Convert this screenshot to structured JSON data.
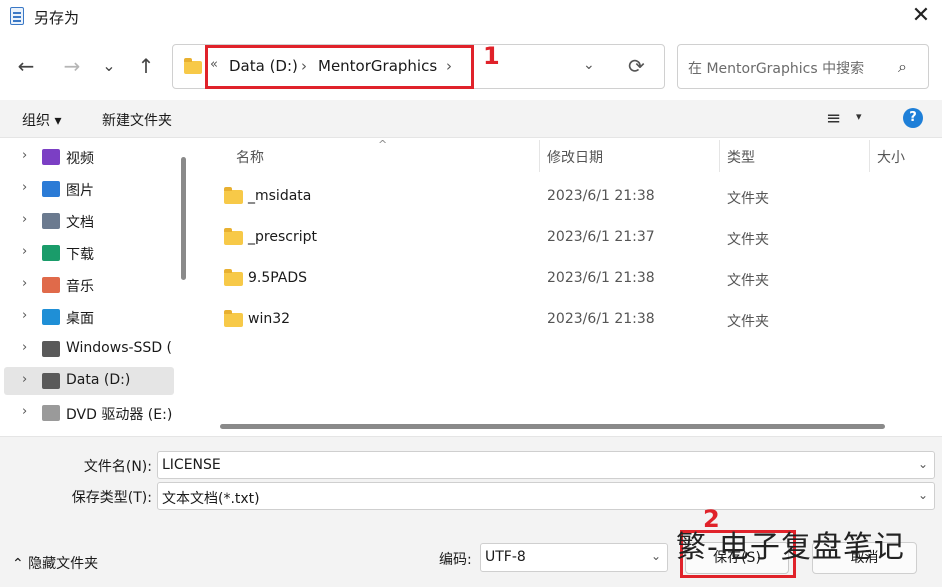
{
  "window": {
    "title": "另存为",
    "close": "✕"
  },
  "nav": {
    "back": "←",
    "forward": "→",
    "recent": "⌄",
    "up": "↑",
    "address": {
      "overflow": "«",
      "segments": [
        "Data (D:)",
        "MentorGraphics"
      ],
      "chevron": "›",
      "dropdown": "⌄",
      "refresh": "⟳"
    },
    "search_placeholder": "在 MentorGraphics 中搜索",
    "search_icon": "⌕"
  },
  "annotations": {
    "label1": "1",
    "label2": "2",
    "color": "#e0222a"
  },
  "toolbar": {
    "organize": "组织 ▾",
    "new_folder": "新建文件夹",
    "view": "≡",
    "view_dropdown": "▾",
    "help": "?"
  },
  "sidebar": {
    "items": [
      {
        "label": "视频",
        "icon": "video-icon",
        "color": "#7b3fc4"
      },
      {
        "label": "图片",
        "icon": "pictures-icon",
        "color": "#2b7bd6"
      },
      {
        "label": "文档",
        "icon": "documents-icon",
        "color": "#6b7a8f"
      },
      {
        "label": "下载",
        "icon": "downloads-icon",
        "color": "#1a9c6a"
      },
      {
        "label": "音乐",
        "icon": "music-icon",
        "color": "#e06a4a"
      },
      {
        "label": "桌面",
        "icon": "desktop-icon",
        "color": "#1f8fd6"
      },
      {
        "label": "Windows-SSD (",
        "icon": "drive-icon",
        "color": "#5a5a5a"
      },
      {
        "label": "Data (D:)",
        "icon": "drive-icon",
        "color": "#5a5a5a",
        "selected": true
      },
      {
        "label": "DVD 驱动器 (E:)",
        "icon": "dvd-icon",
        "color": "#9a9a9a"
      }
    ],
    "chevron": "›"
  },
  "files": {
    "columns": [
      "名称",
      "修改日期",
      "类型",
      "大小"
    ],
    "sort_arrow": "^",
    "rows": [
      {
        "name": "_msidata",
        "date": "2023/6/1 21:38",
        "type": "文件夹"
      },
      {
        "name": "_prescript",
        "date": "2023/6/1 21:37",
        "type": "文件夹"
      },
      {
        "name": "9.5PADS",
        "date": "2023/6/1 21:38",
        "type": "文件夹"
      },
      {
        "name": "win32",
        "date": "2023/6/1 21:38",
        "type": "文件夹"
      }
    ]
  },
  "form": {
    "filename_label": "文件名(N):",
    "filename_value": "LICENSE",
    "filetype_label": "保存类型(T):",
    "filetype_value": "文本文档(*.txt)",
    "dropdown": "⌄",
    "hide_folders": "⌃ 隐藏文件夹",
    "encoding_label": "编码:",
    "encoding_value": "UTF-8",
    "save": "保存(S)",
    "cancel": "取消"
  },
  "watermark": "繁-电子复盘笔记"
}
